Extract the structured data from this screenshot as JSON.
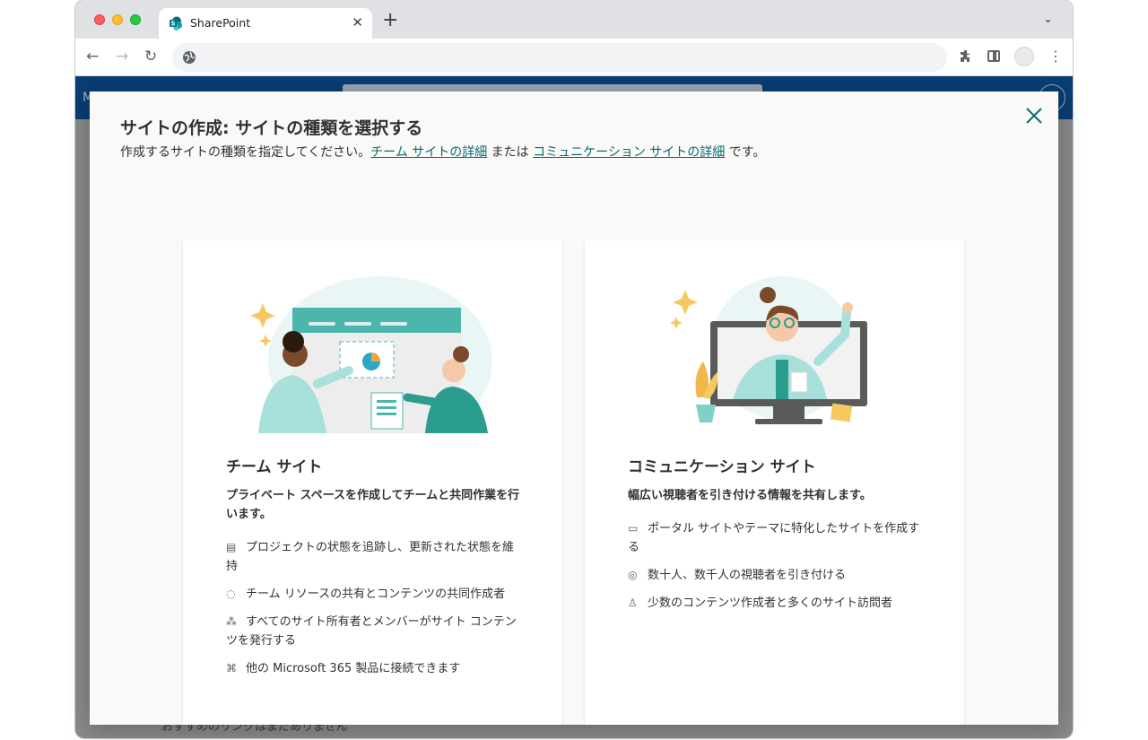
{
  "browser": {
    "tab_title": "SharePoint",
    "tab_close": "✕",
    "new_tab": "+",
    "tab_menu": "⌄",
    "nav": {
      "back": "←",
      "forward": "→",
      "reload": "↻"
    },
    "omnibox_value": "",
    "icons": [
      "sharepoint-logo-icon",
      "globe-icon",
      "extensions-icon",
      "side-panel-icon",
      "profile-icon",
      "menu-icon"
    ]
  },
  "page_behind": {
    "suite_left": "M",
    "bottom_text": "おすすめのリンクはまだありません"
  },
  "dialog": {
    "title": "サイトの作成: サイトの種類を選択する",
    "subtitle_prefix": "作成するサイトの種類を指定してください。",
    "link_team": "チーム サイトの詳細",
    "subtitle_mid": " または ",
    "link_comm": "コミュニケーション サイトの詳細",
    "subtitle_suffix": " です。",
    "close_label": "✕"
  },
  "cards": [
    {
      "title": "チーム サイト",
      "description": "プライベート スペースを作成してチームと共同作業を行います。",
      "features": [
        {
          "icon": "clipboard-icon",
          "glyph": "▤",
          "text": "プロジェクトの状態を追跡し、更新された状態を維持"
        },
        {
          "icon": "sync-icon",
          "glyph": "◌",
          "text": "チーム リソースの共有とコンテンツの共同作成者"
        },
        {
          "icon": "people-network-icon",
          "glyph": "⁂",
          "text": "すべてのサイト所有者とメンバーがサイト コンテンツを発行する"
        },
        {
          "icon": "apps-icon",
          "glyph": "⌘",
          "text": "他の Microsoft 365 製品に接続できます"
        }
      ]
    },
    {
      "title": "コミュニケーション サイト",
      "description": "幅広い視聴者を引き付ける情報を共有します。",
      "features": [
        {
          "icon": "site-edit-icon",
          "glyph": "▭",
          "text": "ポータル サイトやテーマに特化したサイトを作成する"
        },
        {
          "icon": "broadcast-icon",
          "glyph": "◎",
          "text": "数十人、数千人の視聴者を引き付ける"
        },
        {
          "icon": "person-icon",
          "glyph": "♙",
          "text": "少数のコンテンツ作成者と多くのサイト訪問者"
        }
      ]
    }
  ],
  "colors": {
    "link": "#036c70",
    "suite_bar": "#0a3d73",
    "teal": "#4db6ac"
  }
}
